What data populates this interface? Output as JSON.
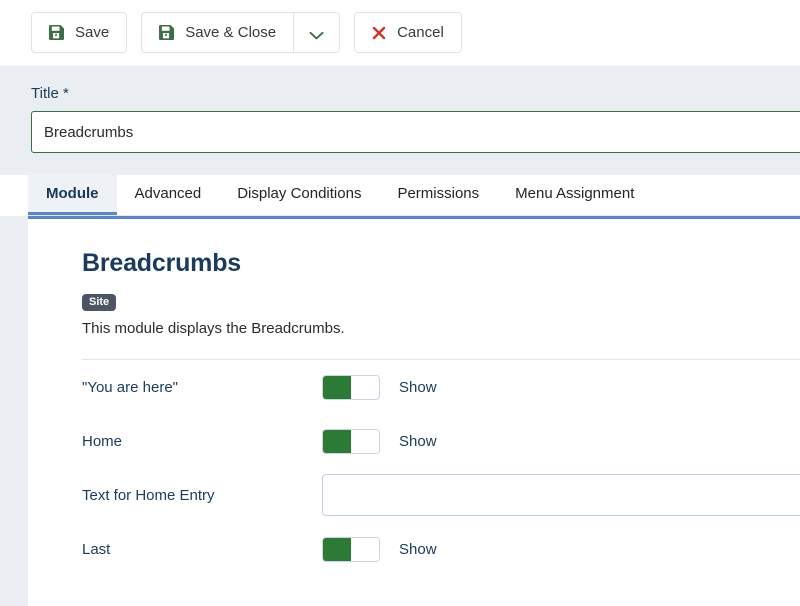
{
  "toolbar": {
    "save_label": "Save",
    "save_close_label": "Save & Close",
    "cancel_label": "Cancel",
    "dropdown_icon": "chevron-down-icon",
    "save_icon": "floppy-disk-icon",
    "cancel_icon": "close-x-icon",
    "accent_green": "#3c6e47",
    "accent_red": "#d0322c"
  },
  "title_field": {
    "label": "Title",
    "required_marker": "*",
    "value": "Breadcrumbs",
    "placeholder": ""
  },
  "tabs": [
    {
      "label": "Module",
      "active": true
    },
    {
      "label": "Advanced",
      "active": false
    },
    {
      "label": "Display Conditions",
      "active": false
    },
    {
      "label": "Permissions",
      "active": false
    },
    {
      "label": "Menu Assignment",
      "active": false
    }
  ],
  "module": {
    "heading": "Breadcrumbs",
    "badge": "Site",
    "description": "This module displays the Breadcrumbs."
  },
  "fields": [
    {
      "label": "\"You are here\"",
      "type": "toggle",
      "state_label": "Show",
      "on": true
    },
    {
      "label": "Home",
      "type": "toggle",
      "state_label": "Show",
      "on": true
    },
    {
      "label": "Text for Home Entry",
      "type": "text",
      "value": "",
      "placeholder": ""
    },
    {
      "label": "Last",
      "type": "toggle",
      "state_label": "Show",
      "on": true
    }
  ]
}
